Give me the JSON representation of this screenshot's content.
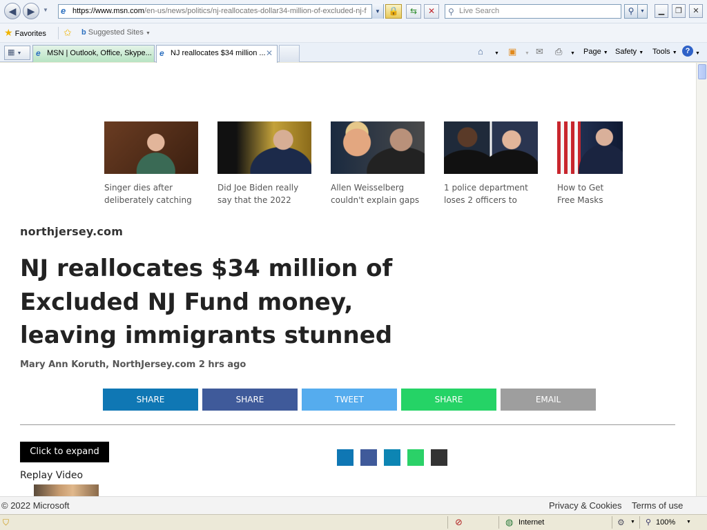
{
  "browser": {
    "url_proto": "https://www.",
    "url_host": "msn.com",
    "url_path": "/en-us/news/politics/nj-reallocates-dollar34-million-of-excluded-nj-f",
    "search_placeholder": "Live Search",
    "favorites_label": "Favorites",
    "suggested_sites_label": "Suggested Sites",
    "tabs": [
      {
        "label": "MSN | Outlook, Office, Skype..."
      },
      {
        "label": "NJ reallocates $34 million ..."
      }
    ],
    "commands": {
      "page": "Page",
      "safety": "Safety",
      "tools": "Tools"
    }
  },
  "trending": [
    {
      "caption": "Singer dies after deliberately catching",
      "icon": "photo-woman-smiling"
    },
    {
      "caption": "Did Joe Biden really say that the 2022",
      "icon": "photo-man-at-podium"
    },
    {
      "caption": "Allen Weisselberg couldn't explain gaps",
      "icon": "photo-two-men"
    },
    {
      "caption": "1 police department loses 2 officers to",
      "icon": "photo-police-officers"
    },
    {
      "caption": "How to Get Free Masks From the",
      "icon": "photo-man-with-mask"
    }
  ],
  "article": {
    "source": "northjersey.com",
    "headline": "NJ reallocates $34 million of Excluded NJ Fund money, leaving immigrants stunned",
    "byline": "Mary Ann Koruth, NorthJersey.com 2 hrs ago",
    "share_buttons": [
      {
        "label": "SHARE",
        "color": "#0F77B4"
      },
      {
        "label": "SHARE",
        "color": "#3F5A9A"
      },
      {
        "label": "TWEET",
        "color": "#55ACEE"
      },
      {
        "label": "SHARE",
        "color": "#25D366"
      },
      {
        "label": "EMAIL",
        "color": "#9E9E9E"
      }
    ],
    "expand_label": "Click to expand",
    "replay_label": "Replay Video",
    "share_squares": [
      "#0F77B4",
      "#3F5A9A",
      "#0D85B3",
      "#2BD168",
      "#333333"
    ]
  },
  "footer": {
    "copyright": "© 2022 Microsoft",
    "privacy": "Privacy & Cookies",
    "terms": "Terms of use"
  },
  "status": {
    "zone": "Internet",
    "zoom": "100%"
  }
}
